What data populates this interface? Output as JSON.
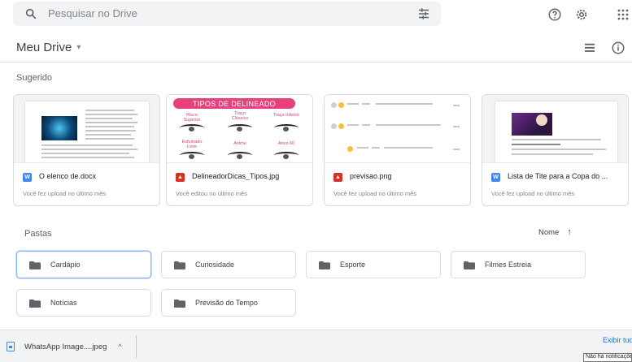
{
  "search": {
    "placeholder": "Pesquisar no Drive"
  },
  "header": {
    "title": "Meu Drive",
    "caret": "▾"
  },
  "suggested": {
    "label": "Sugerido",
    "cards": [
      {
        "name": "O elenco de.docx",
        "sub": "Você fez upload no último mês",
        "type": "W",
        "type_color": "#4285f4"
      },
      {
        "name": "DelineadorDicas_Tipos.jpg",
        "sub": "Você editou no último mês",
        "type": "▲",
        "type_color": "#d93025"
      },
      {
        "name": "previsao.png",
        "sub": "Você fez upload no último mês",
        "type": "▲",
        "type_color": "#d93025"
      },
      {
        "name": "Lista de Tite para a Copa do ...",
        "sub": "Você fez upload no último mês",
        "type": "W",
        "type_color": "#4285f4"
      }
    ],
    "thumb2": {
      "title": "TIPOS DE DELINEADO",
      "labels": [
        "Risco Superior",
        "Traço Clássico",
        "Traço Inferior",
        "Esfumado Leve",
        "Anime",
        "Anos 60"
      ]
    }
  },
  "folders": {
    "label": "Pastas",
    "sort_label": "Nome",
    "sort_arrow": "↑",
    "items": [
      {
        "name": "Cardápio"
      },
      {
        "name": "Curiosidade"
      },
      {
        "name": "Esporte"
      },
      {
        "name": "Filmes Estreia"
      },
      {
        "name": "Notícias"
      },
      {
        "name": "Previsão do Tempo"
      }
    ]
  },
  "downloads": {
    "item": "WhatsApp Image....jpeg",
    "chevron": "^",
    "show_all": "Exibir tudo",
    "tooltip": "Não há notificações"
  },
  "colors": {
    "accent": "#1a73e8",
    "selected_border": "#8ab4f8",
    "folder_icon": "#5f6368"
  }
}
